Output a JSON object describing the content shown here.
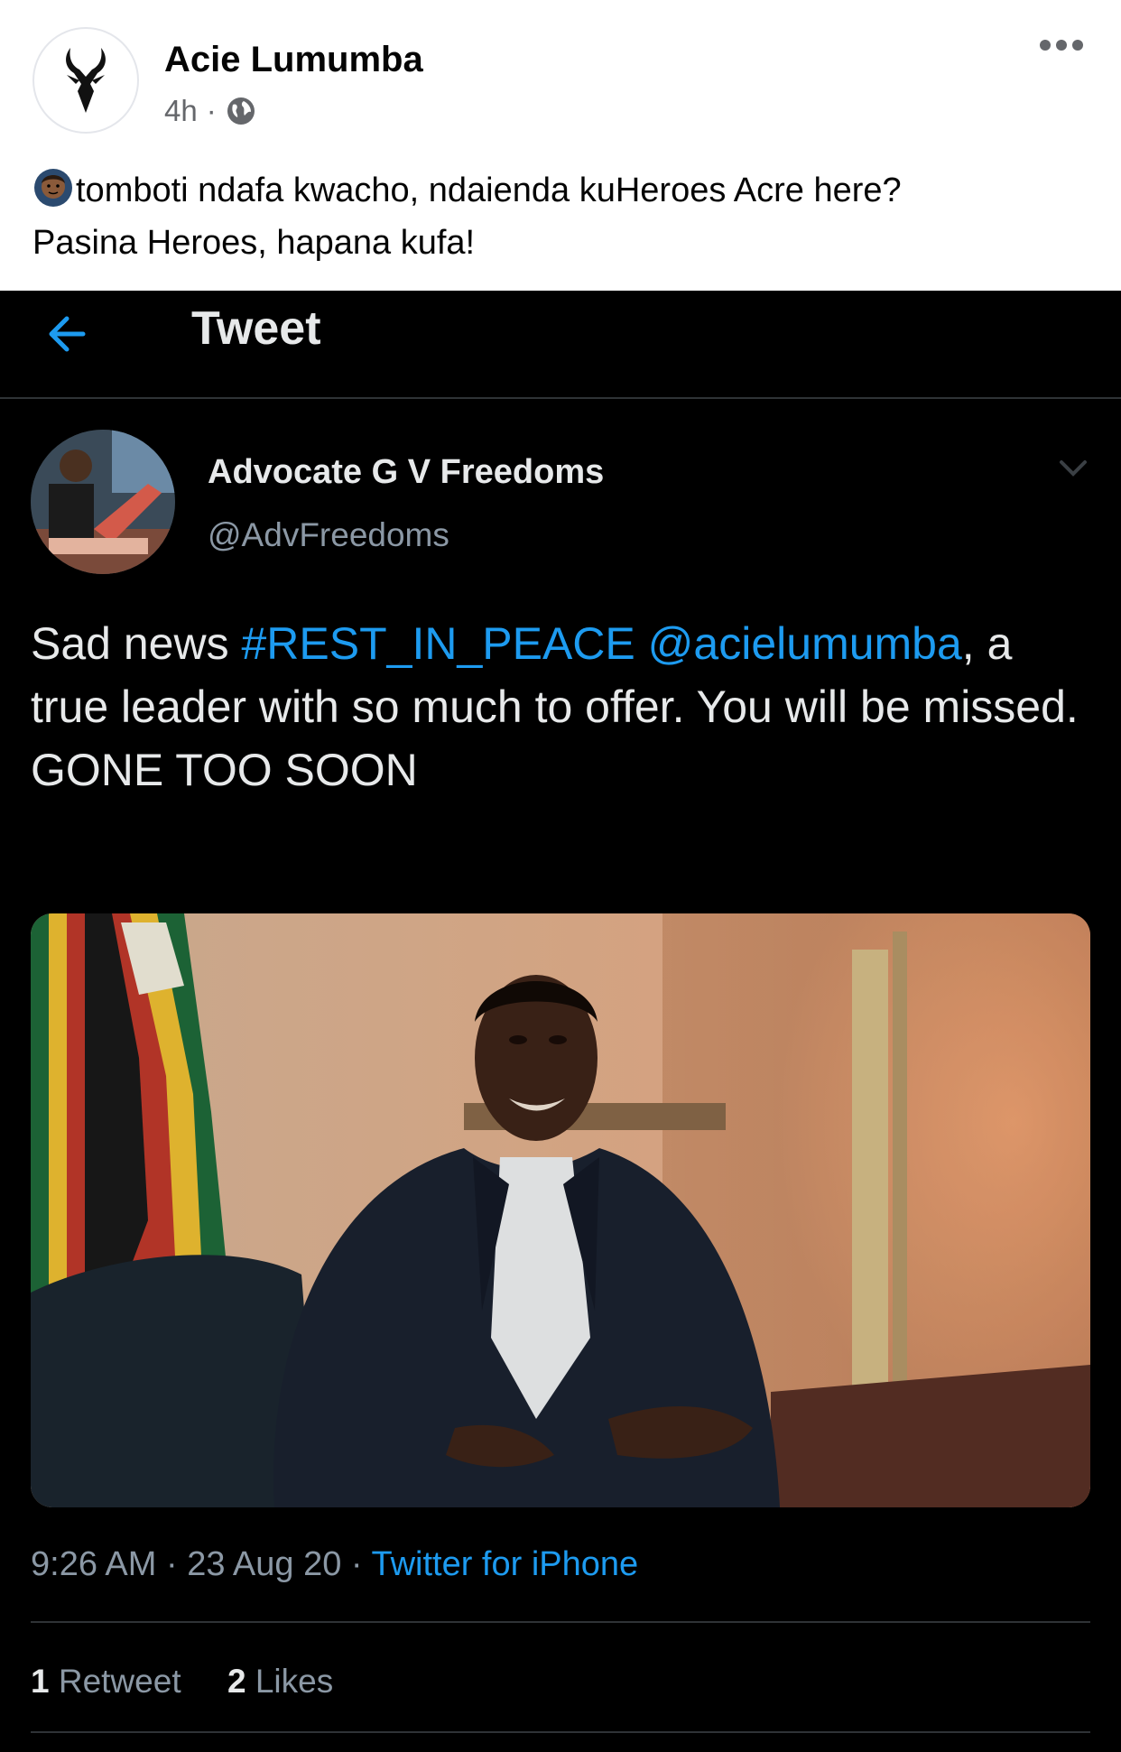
{
  "post": {
    "author": "Acie Lumumba",
    "time": "4h",
    "separator": "·",
    "text_line1": "tomboti ndafa kwacho, ndaienda kuHeroes Acre here?",
    "text_line2": "Pasina Heroes, hapana kufa!",
    "emoji_icon": "woman-gesturing-emoji",
    "privacy_icon": "globe-icon",
    "menu_icon": "more-horizontal-icon"
  },
  "tweet": {
    "header_title": "Tweet",
    "display_name": "Advocate G V Freedoms",
    "handle": "@AdvFreedoms",
    "text_plain1": "Sad news ",
    "hashtag": "#REST_IN_PEACE",
    "space": " ",
    "mention": "@acielumumba",
    "text_plain2": ", a true leader with so much to offer. You will be missed.",
    "text_line_last": "GONE TOO SOON",
    "time": "9:26 AM",
    "dot": " · ",
    "date": "23 Aug 20",
    "source": "Twitter for iPhone",
    "retweet_count": "1",
    "retweet_label": "Retweet",
    "like_count": "2",
    "like_label": "Likes"
  },
  "colors": {
    "link": "#1d9bf0",
    "tweet_bg": "#000000",
    "post_bg": "#ffffff"
  }
}
